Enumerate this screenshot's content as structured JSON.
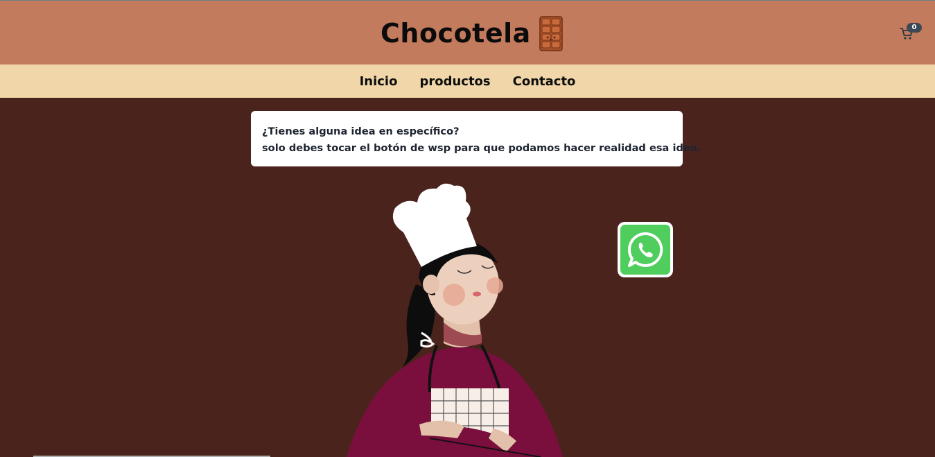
{
  "header": {
    "brand": "Chocotela",
    "cart_count": "0"
  },
  "nav": {
    "items": [
      {
        "label": "Inicio"
      },
      {
        "label": "productos"
      },
      {
        "label": "Contacto"
      }
    ]
  },
  "main": {
    "message_line1": "¿Tienes alguna idea en específico?",
    "message_line2": "solo debes tocar el botón de wsp para que podamos hacer realidad esa idea."
  },
  "colors": {
    "header_bg": "#c37b5d",
    "nav_bg": "#f0d6a8",
    "page_bg": "#4a231c",
    "whatsapp_green": "#4fce5d"
  },
  "icons": {
    "brand_icon": "chocolate-bar-icon",
    "cart_icon": "shopping-cart-icon",
    "whatsapp_icon": "whatsapp-icon"
  }
}
